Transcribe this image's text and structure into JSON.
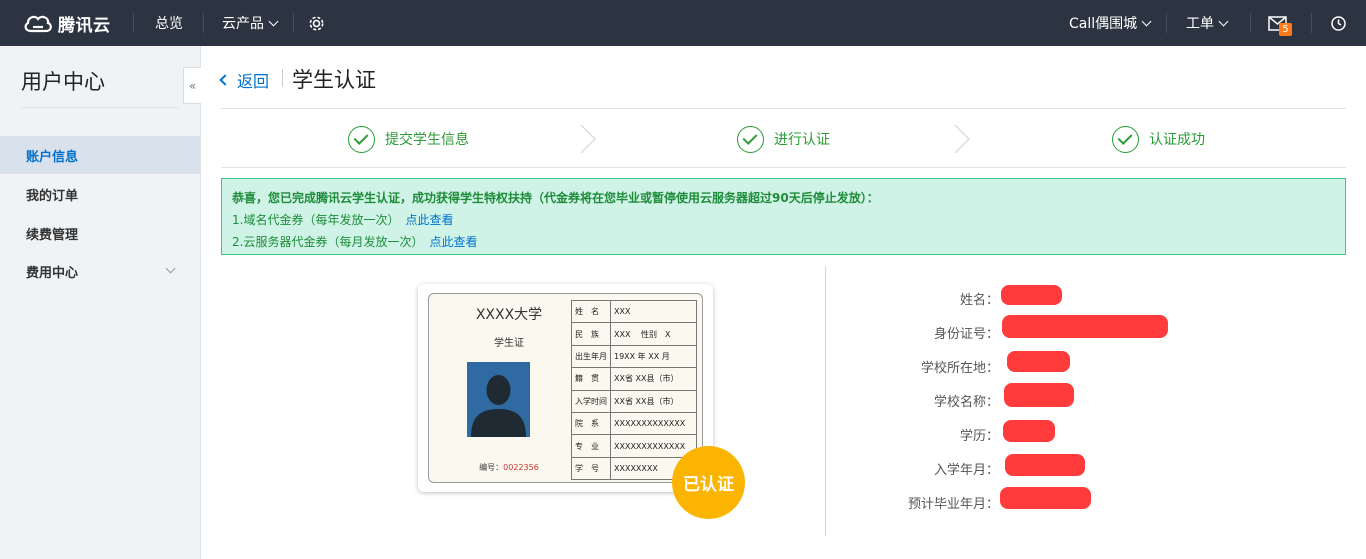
{
  "topbar": {
    "brand": "腾讯云",
    "nav_overview": "总览",
    "nav_products": "云产品",
    "user_name": "Call偶围城",
    "ticket": "工单",
    "mail_count": "5",
    "icons": [
      "cloud-logo-icon",
      "settings-gear-icon",
      "mail-icon",
      "history-clock-icon"
    ]
  },
  "sidebar": {
    "title": "用户中心",
    "items": [
      {
        "label": "账户信息",
        "active": true
      },
      {
        "label": "我的订单",
        "active": false
      },
      {
        "label": "续费管理",
        "active": false
      },
      {
        "label": "费用中心",
        "active": false
      }
    ]
  },
  "main": {
    "back_label": "返回",
    "title": "学生认证",
    "steps": [
      {
        "label": "提交学生信息"
      },
      {
        "label": "进行认证"
      },
      {
        "label": "认证成功"
      }
    ],
    "notice": {
      "headline": "恭喜，您已完成腾讯云学生认证，成功获得学生特权扶持（代金券将在您毕业或暂停使用云服务器超过90天后停止发放）：",
      "line1": "1.域名代金券（每年发放一次）",
      "line1_link": "点此查看",
      "line2": "2.云服务器代金券（每月发放一次）",
      "line2_link": "点此查看"
    },
    "card": {
      "school": "XXXX大学",
      "subtitle": "学生证",
      "number_label": "编号：",
      "number_value": "0022356",
      "rows": [
        {
          "label": "姓　名",
          "value": "XXX"
        },
        {
          "label": "民　族",
          "value": "XXX　 性别　X"
        },
        {
          "label": "出生年月",
          "value": "19XX 年 XX 月"
        },
        {
          "label": "籍　贯",
          "value": "XX省  XX县（市）"
        },
        {
          "label": "入学时间",
          "value": "XX省  XX县（市）"
        },
        {
          "label": "院　系",
          "value": "XXXXXXXXXXXXX"
        },
        {
          "label": "专　业",
          "value": "XXXXXXXXXXXXX"
        },
        {
          "label": "学　号",
          "value": "XXXXXXXX"
        }
      ],
      "badge": "已认证"
    },
    "info": {
      "labels": [
        "姓名：",
        "身份证号：",
        "学校所在地：",
        "学校名称：",
        "学历：",
        "入学年月：",
        "预计毕业年月："
      ]
    }
  },
  "colors": {
    "topbar_bg": "#2b3440",
    "link_blue": "#0071ce",
    "success_green": "#2b9b36",
    "notice_bg": "#cff3e6",
    "badge_yellow": "#fbb500",
    "redaction_red": "#ff3b3b"
  }
}
